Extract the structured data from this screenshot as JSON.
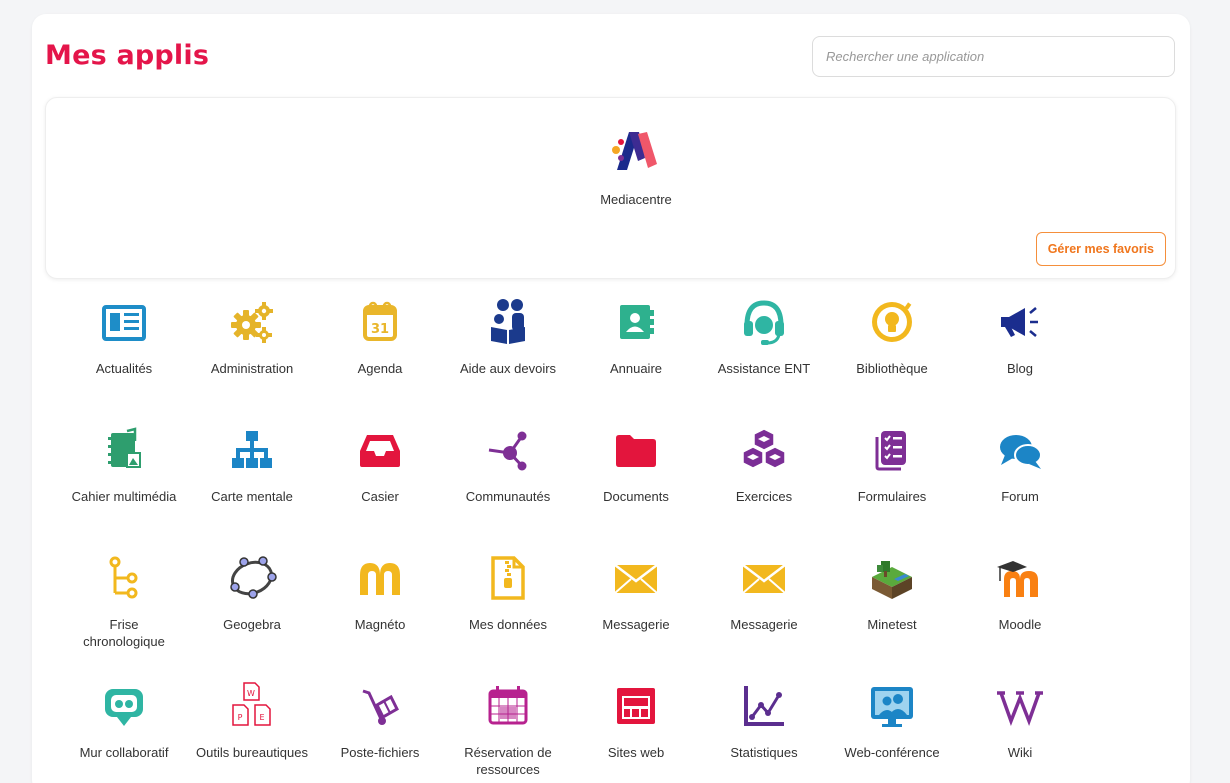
{
  "header": {
    "title": "Mes applis",
    "search_placeholder": "Rechercher une application"
  },
  "favorites": {
    "apps": [
      {
        "label": "Mediacentre",
        "icon": "mediacentre-logo-icon"
      }
    ],
    "manage_label": "Gérer mes favoris"
  },
  "apps": [
    {
      "label": "Actualités",
      "icon": "newspaper-icon",
      "color": "#1e8dc8"
    },
    {
      "label": "Administration",
      "icon": "gears-icon",
      "color": "#e5b42a"
    },
    {
      "label": "Agenda",
      "icon": "calendar-icon",
      "color": "#e9b62b"
    },
    {
      "label": "Aide aux devoirs",
      "icon": "homework-help-icon",
      "color": "#1b3a8c"
    },
    {
      "label": "Annuaire",
      "icon": "address-book-icon",
      "color": "#2eb18e"
    },
    {
      "label": "Assistance ENT",
      "icon": "headset-icon",
      "color": "#2fb5a3"
    },
    {
      "label": "Bibliothèque",
      "icon": "lightbulb-icon",
      "color": "#f2b81e"
    },
    {
      "label": "Blog",
      "icon": "megaphone-icon",
      "color": "#1b2d8e"
    },
    {
      "label": "Cahier multimédia",
      "icon": "multimedia-notebook-icon",
      "color": "#2e9e6e"
    },
    {
      "label": "Carte mentale",
      "icon": "sitemap-icon",
      "color": "#1c85c6"
    },
    {
      "label": "Casier",
      "icon": "inbox-tray-icon",
      "color": "#e3153d"
    },
    {
      "label": "Communautés",
      "icon": "share-nodes-icon",
      "color": "#7e2f95"
    },
    {
      "label": "Documents",
      "icon": "folder-icon",
      "color": "#e3153d"
    },
    {
      "label": "Exercices",
      "icon": "cubes-icon",
      "color": "#7b2e96"
    },
    {
      "label": "Formulaires",
      "icon": "checklist-form-icon",
      "color": "#7e2f95"
    },
    {
      "label": "Forum",
      "icon": "chat-bubbles-icon",
      "color": "#1c85c6"
    },
    {
      "label": "Frise\nchronologique",
      "icon": "timeline-icon",
      "color": "#f2b81e"
    },
    {
      "label": "Geogebra",
      "icon": "geogebra-icon",
      "color": "#444444"
    },
    {
      "label": "Magnéto",
      "icon": "magneto-icon",
      "color": "#f2b81e"
    },
    {
      "label": "Mes données",
      "icon": "zip-file-icon",
      "color": "#f2b81e"
    },
    {
      "label": "Messagerie",
      "icon": "envelope-icon",
      "color": "#f2b81e"
    },
    {
      "label": "Messagerie",
      "icon": "envelope-icon",
      "color": "#f2b81e"
    },
    {
      "label": "Minetest",
      "icon": "minetest-icon",
      "color": "#3e8a3a"
    },
    {
      "label": "Moodle",
      "icon": "moodle-icon",
      "color": "#f98012"
    },
    {
      "label": "Mur collaboratif",
      "icon": "collaborative-wall-icon",
      "color": "#2fb5a3"
    },
    {
      "label": "Outils bureautiques",
      "icon": "office-tools-icon",
      "color": "#e3153d"
    },
    {
      "label": "Poste-fichiers",
      "icon": "hand-truck-icon",
      "color": "#7e2f95"
    },
    {
      "label": "Réservation de\nressources",
      "icon": "booking-calendar-icon",
      "color": "#b7228f"
    },
    {
      "label": "Sites web",
      "icon": "website-icon",
      "color": "#e3153d"
    },
    {
      "label": "Statistiques",
      "icon": "line-chart-icon",
      "color": "#5b2e8f"
    },
    {
      "label": "Web-conférence",
      "icon": "video-conference-icon",
      "color": "#1c85c6"
    },
    {
      "label": "Wiki",
      "icon": "wikipedia-icon",
      "color": "#7e2f95"
    }
  ]
}
